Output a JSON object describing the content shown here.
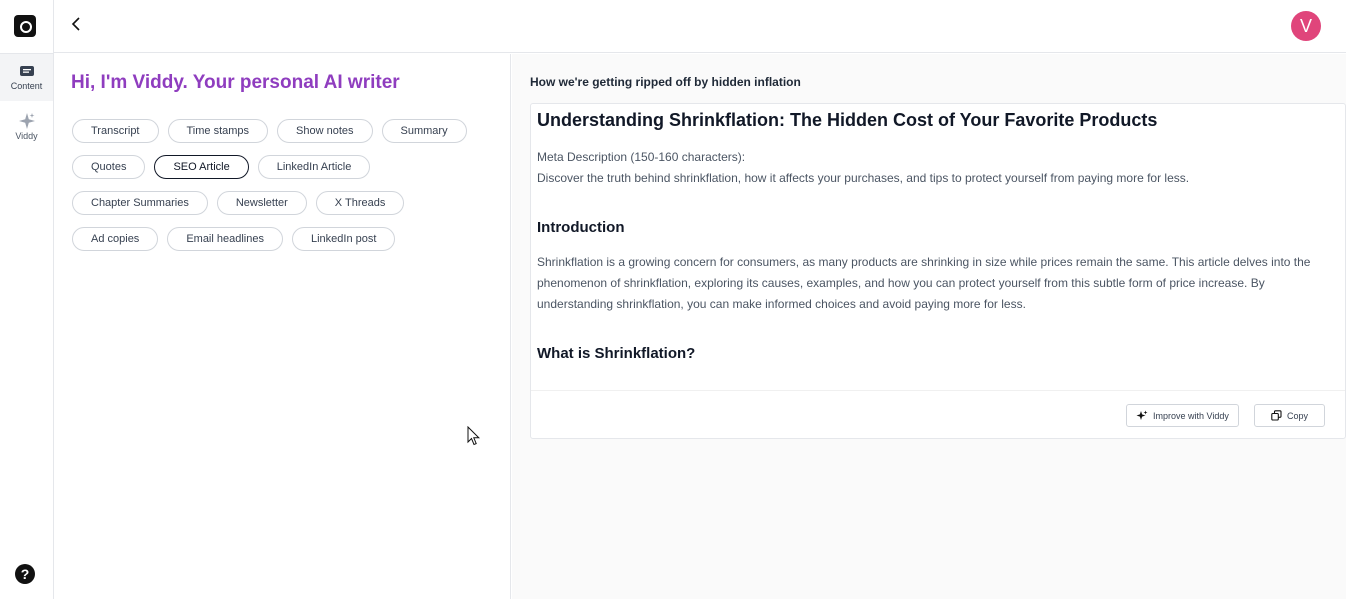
{
  "rail": {
    "items": [
      {
        "label": "Content",
        "icon": "content-icon"
      },
      {
        "label": "Viddy",
        "icon": "sparkle-icon"
      }
    ],
    "help": "?"
  },
  "topbar": {
    "avatar_initial": "V"
  },
  "left": {
    "greeting": "Hi, I'm Viddy. Your personal AI writer",
    "chip_rows": [
      [
        "Transcript",
        "Time stamps",
        "Show notes",
        "Summary"
      ],
      [
        "Quotes",
        "SEO Article",
        "LinkedIn Article"
      ],
      [
        "Chapter Summaries",
        "Newsletter",
        "X Threads"
      ],
      [
        "Ad copies",
        "Email headlines",
        "LinkedIn post"
      ]
    ],
    "selected_chip": "SEO Article"
  },
  "right": {
    "title": "How we're getting ripped off by hidden inflation",
    "article": {
      "h1": "Understanding Shrinkflation: The Hidden Cost of Your Favorite Products",
      "meta_label": "Meta Description (150-160 characters):",
      "meta_text": "Discover the truth behind shrinkflation, how it affects your purchases, and tips to protect yourself from paying more for less.",
      "intro_heading": "Introduction",
      "intro_text": "Shrinkflation is a growing concern for consumers, as many products are shrinking in size while prices remain the same. This article delves into the phenomenon of shrinkflation, exploring its causes, examples, and how you can protect yourself from this subtle form of price increase. By understanding shrinkflation, you can make informed choices and avoid paying more for less.",
      "section_heading": "What is Shrinkflation?"
    },
    "buttons": {
      "improve": "Improve with Viddy",
      "copy": "Copy"
    }
  }
}
